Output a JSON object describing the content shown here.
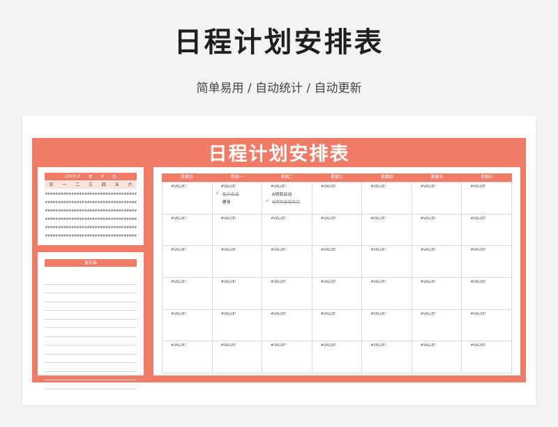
{
  "header": {
    "title": "日程计划安排表",
    "subtitle": "简单易用 / 自动统计 / 自动更新"
  },
  "sheet": {
    "title": "日程计划安排表",
    "mini_calendar": {
      "year": "20XX.0",
      "year_unit": "年",
      "month": "8",
      "month_unit": "月",
      "weekdays": [
        "日",
        "一",
        "二",
        "三",
        "四",
        "五",
        "六"
      ],
      "rows": [
        [
          "#####",
          "#####",
          "#####",
          "#####",
          "#####",
          "#####",
          "#####"
        ],
        [
          "#####",
          "#####",
          "#####",
          "#####",
          "#####",
          "#####",
          "#####"
        ],
        [
          "#####",
          "#####",
          "#####",
          "#####",
          "#####",
          "#####",
          "#####"
        ],
        [
          "#####",
          "#####",
          "#####",
          "#####",
          "#####",
          "#####",
          "#####"
        ],
        [
          "#####",
          "#####",
          "#####",
          "#####",
          "#####",
          "#####",
          "#####"
        ],
        [
          "#####",
          "#####",
          "#####",
          "#####",
          "#####",
          "#####",
          "#####"
        ]
      ]
    },
    "memo": {
      "title": "备忘录",
      "line_count": 13
    },
    "calendar": {
      "headers": [
        "星期日",
        "星期一",
        "星期二",
        "星期三",
        "星期四",
        "星期五",
        "星期六"
      ],
      "cell_value": "#VALUE!",
      "row_count": 6,
      "tasks": {
        "mon": [
          {
            "check": "√",
            "text": "客户会谈",
            "done": true
          },
          {
            "check": "",
            "text": "健身",
            "done": false
          }
        ],
        "tue": [
          {
            "check": "",
            "text": "A项目启动",
            "done": false
          },
          {
            "check": "√",
            "text": "B项目总结大会",
            "done": true
          }
        ]
      }
    }
  },
  "colors": {
    "accent": "#f07b67",
    "accent_light": "#fde3dc",
    "background": "#f3f3f3"
  }
}
